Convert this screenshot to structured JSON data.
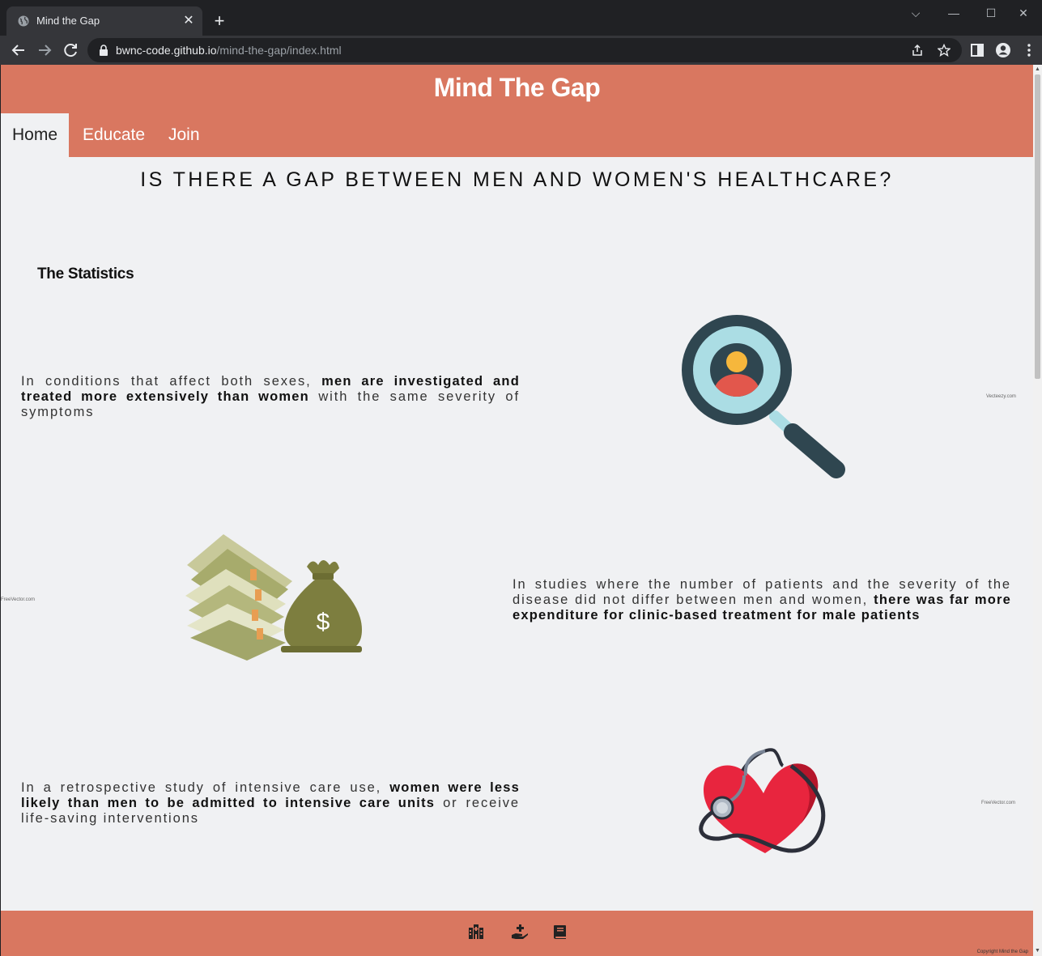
{
  "browser": {
    "tab_title": "Mind the Gap",
    "url_host": "bwnc-code.github.io",
    "url_path": "/mind-the-gap/index.html"
  },
  "site": {
    "title": "Mind The Gap",
    "nav": [
      {
        "label": "Home",
        "active": true
      },
      {
        "label": "Educate",
        "active": false
      },
      {
        "label": "Join",
        "active": false
      }
    ],
    "headline": "IS THERE A GAP BETWEEN MEN AND WOMEN'S HEALTHCARE?",
    "section_title": "The Statistics",
    "stats": [
      {
        "pre": "In conditions that affect both sexes, ",
        "bold": "men are investigated and treated more extensively than women",
        "post": " with the same severity of symptoms",
        "image": "magnifier-person-icon",
        "credit": "Vecteezy.com"
      },
      {
        "pre": "In studies where the number of patients and the severity of the disease did not differ between men and women, ",
        "bold": "there was far more expenditure for clinic-based treatment for male patients",
        "post": "",
        "image": "money-stack-icon",
        "credit": "FreeVector.com"
      },
      {
        "pre": "In a retrospective study of intensive care use, ",
        "bold": "women were less likely than men to be admitted to intensive care units",
        "post": " or receive life-saving interventions",
        "image": "heart-stethoscope-icon",
        "credit": "FreeVector.com"
      }
    ],
    "footer_icons": [
      "hospital-icon",
      "hand-donate-icon",
      "book-icon"
    ],
    "copyright": "Copyright Mind the Gap",
    "colors": {
      "header": "#d97760",
      "page_bg": "#f0f1f3",
      "magnifier_dark": "#2f4650",
      "magnifier_lens": "#abdde4",
      "person_head": "#f6b73c",
      "person_body": "#e2574c",
      "money_green": "#7d7e3f",
      "heart_red": "#e8253e"
    }
  }
}
